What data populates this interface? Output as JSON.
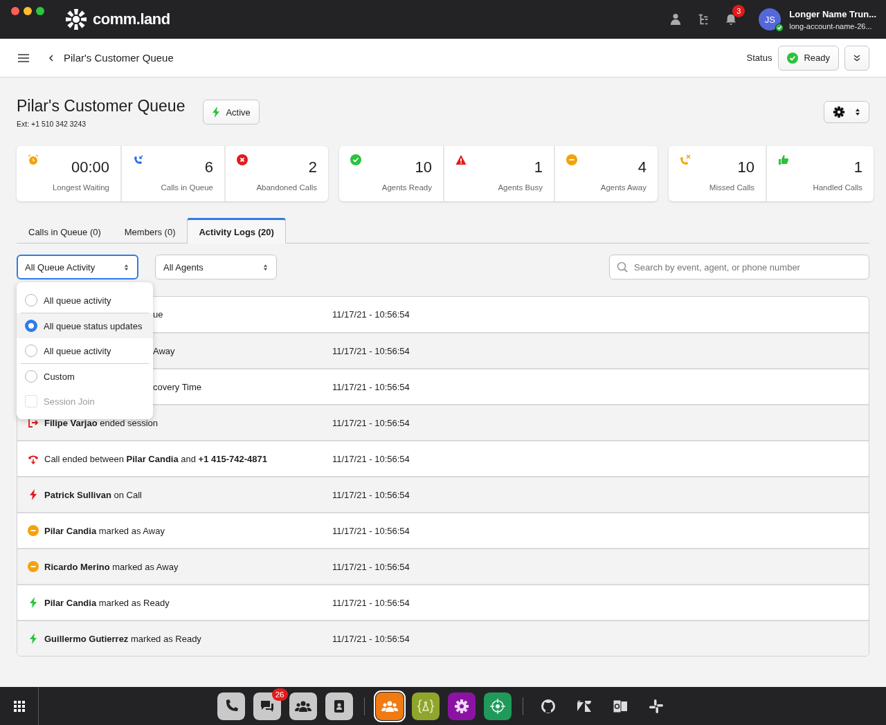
{
  "app": {
    "brand": "comm.land",
    "notifications": "3",
    "user": {
      "initials": "JS",
      "name": "Longer Name Trun...",
      "account": "long-account-name-26..."
    }
  },
  "header": {
    "title": "Pilar's Customer Queue",
    "status_label": "Status",
    "status": "Ready"
  },
  "queue": {
    "title": "Pilar's Customer Queue",
    "ext": "Ext: +1 510 342 3243",
    "state": "Active"
  },
  "stat_groups": [
    [
      {
        "kind": "alarm",
        "value": "00:00",
        "label": "Longest Waiting"
      },
      {
        "kind": "incoming",
        "value": "6",
        "label": "Calls in Queue"
      },
      {
        "kind": "abandoned",
        "value": "2",
        "label": "Abandoned Calls"
      }
    ],
    [
      {
        "kind": "ready",
        "value": "10",
        "label": "Agents Ready"
      },
      {
        "kind": "busy",
        "value": "1",
        "label": "Agents Busy"
      },
      {
        "kind": "away",
        "value": "4",
        "label": "Agents Away"
      }
    ],
    [
      {
        "kind": "missed",
        "value": "10",
        "label": "Missed Calls"
      },
      {
        "kind": "handled",
        "value": "1",
        "label": "Handled Calls"
      }
    ]
  ],
  "tabs": [
    {
      "label": "Calls in Queue (0)",
      "selected": false
    },
    {
      "label": "Members (0)",
      "selected": false
    },
    {
      "label": "Activity Logs (20)",
      "selected": true
    }
  ],
  "filters": {
    "activity": "All Queue Activity",
    "agents": "All Agents",
    "search": {
      "placeholder": "Search by event, agent, or phone number"
    }
  },
  "activity_menu": [
    {
      "kind": "radio",
      "label": "All queue activity",
      "selected": false,
      "disabled": false
    },
    {
      "kind": "radio",
      "label": "All queue status updates",
      "selected": true,
      "disabled": false
    },
    {
      "kind": "radio",
      "label": "All queue activity",
      "selected": false,
      "disabled": false
    },
    {
      "kind": "radio",
      "label": "Custom",
      "selected": false,
      "disabled": false
    },
    {
      "kind": "checkbox",
      "label": "Session Join",
      "selected": false,
      "disabled": true
    }
  ],
  "logs": [
    {
      "kind": "covered",
      "text": "ue",
      "time": "11/17/21 - 10:56:54"
    },
    {
      "kind": "covered",
      "text": "Away",
      "time": "11/17/21 - 10:56:54"
    },
    {
      "kind": "covered",
      "text": "covery Time",
      "time": "11/17/21 - 10:56:54"
    },
    {
      "kind": "session_end",
      "text": "**Filipe Varjao** ended session",
      "time": "11/17/21 - 10:56:54"
    },
    {
      "kind": "call_end",
      "text": "Call ended between **Pilar Candia** and **+1 415-742-4871**",
      "time": "11/17/21 - 10:56:54"
    },
    {
      "kind": "on_call",
      "text": "**Patrick Sullivan** on Call",
      "time": "11/17/21 - 10:56:54"
    },
    {
      "kind": "away",
      "text": "**Pilar Candia** marked as Away",
      "time": "11/17/21 - 10:56:54"
    },
    {
      "kind": "away",
      "text": "**Ricardo Merino** marked as Away",
      "time": "11/17/21 - 10:56:54"
    },
    {
      "kind": "ready",
      "text": "**Pilar Candia** marked as Ready",
      "time": "11/17/21 - 10:56:54"
    },
    {
      "kind": "ready",
      "text": "**Guillermo Gutierrez** marked as Ready",
      "time": "11/17/21 - 10:56:54"
    }
  ],
  "dock": {
    "apps": [
      {
        "kind": "phone",
        "active": false
      },
      {
        "kind": "chat",
        "badge": "26",
        "active": false
      },
      {
        "kind": "team",
        "active": false
      },
      {
        "kind": "contacts",
        "active": false
      },
      {
        "kind": "queue",
        "active": true
      },
      {
        "kind": "lab",
        "active": false
      },
      {
        "kind": "gear",
        "active": false
      },
      {
        "kind": "target",
        "active": false
      },
      {
        "kind": "github",
        "active": false
      },
      {
        "kind": "zendesk",
        "active": false
      },
      {
        "kind": "outlook",
        "active": false
      },
      {
        "kind": "slack",
        "active": false
      }
    ]
  }
}
